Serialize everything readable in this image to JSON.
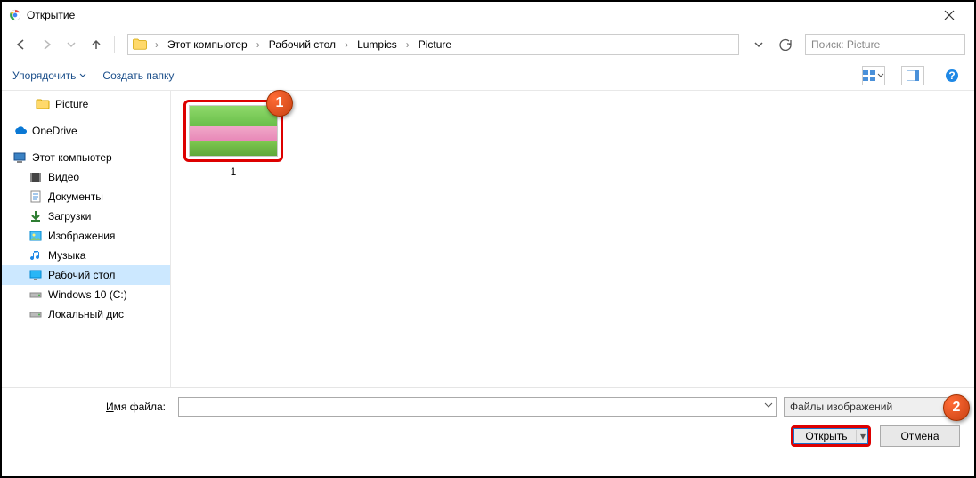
{
  "window": {
    "title": "Открытие"
  },
  "nav": {
    "breadcrumb": [
      "Этот компьютер",
      "Рабочий стол",
      "Lumpics",
      "Picture"
    ],
    "search_placeholder": "Поиск: Picture"
  },
  "toolbar": {
    "organize": "Упорядочить",
    "new_folder": "Создать папку"
  },
  "sidebar": {
    "items": [
      {
        "label": "Picture",
        "icon": "folder",
        "indent": 2
      },
      {
        "label": "OneDrive",
        "icon": "onedrive",
        "indent": 0
      },
      {
        "label": "Этот компьютер",
        "icon": "pc",
        "indent": 0
      },
      {
        "label": "Видео",
        "icon": "video",
        "indent": 1
      },
      {
        "label": "Документы",
        "icon": "docs",
        "indent": 1
      },
      {
        "label": "Загрузки",
        "icon": "downloads",
        "indent": 1
      },
      {
        "label": "Изображения",
        "icon": "images",
        "indent": 1
      },
      {
        "label": "Музыка",
        "icon": "music",
        "indent": 1
      },
      {
        "label": "Рабочий стол",
        "icon": "desktop",
        "indent": 1,
        "selected": true
      },
      {
        "label": "Windows 10 (C:)",
        "icon": "drive",
        "indent": 1
      },
      {
        "label": "Локальный дис",
        "icon": "drive",
        "indent": 1
      }
    ]
  },
  "files": [
    {
      "name": "1"
    }
  ],
  "callouts": {
    "one": "1",
    "two": "2"
  },
  "bottom": {
    "filename_label": "Имя файла:",
    "filename_value": "",
    "filter": "Файлы изображений",
    "open": "Открыть",
    "cancel": "Отмена"
  }
}
